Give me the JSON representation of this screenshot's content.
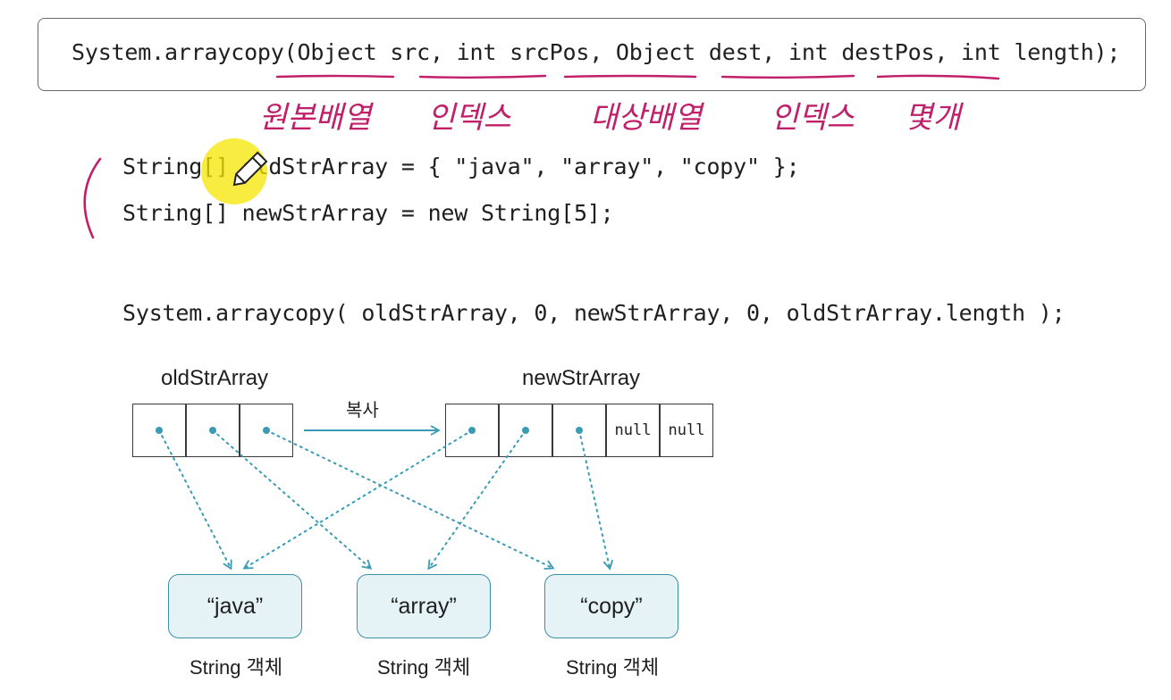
{
  "signature": "System.arraycopy(Object src, int srcPos, Object dest, int destPos, int length);",
  "annotations": {
    "src": "원본배열",
    "src_pos": "인덱스",
    "dest": "대상배열",
    "dest_pos": "인덱스",
    "length": "몇개"
  },
  "code": {
    "line1": "String[] oldStrArray = { \"java\", \"array\", \"copy\" };",
    "line2": "String[] newStrArray = new String[5];",
    "call": "System.arraycopy( oldStrArray, 0, newStrArray, 0, oldStrArray.length );"
  },
  "diagram": {
    "old_label": "oldStrArray",
    "new_label": "newStrArray",
    "copy_label": "복사",
    "null_text": "null",
    "objects": [
      "“java”",
      "“array”",
      "“copy”"
    ],
    "object_caption": "String 객체"
  },
  "colors": {
    "annotation": "#c0206a",
    "arrow": "#3b9bb5",
    "object_fill": "#e6f3f6",
    "object_border": "#3d8fa3",
    "highlight": "#f5e600"
  }
}
